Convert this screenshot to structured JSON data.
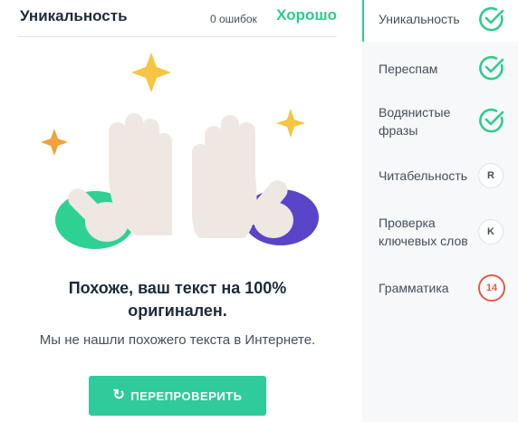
{
  "panel": {
    "title": "Уникальность",
    "errors": "0 ошибок",
    "verdict": "Хорошо"
  },
  "result": {
    "title": "Похоже, ваш текст на 100% оригинален.",
    "subtitle": "Мы не нашли похожего текста в Интернете.",
    "recheck_label": "ПЕРЕПРОВЕРИТЬ"
  },
  "sidebar": {
    "items": [
      {
        "label": "Уникальность",
        "status": "check",
        "active": true
      },
      {
        "label": "Переспам",
        "status": "check",
        "active": false
      },
      {
        "label": "Водянистые фразы",
        "status": "check",
        "active": false
      },
      {
        "label": "Читабельность",
        "status": "R",
        "active": false
      },
      {
        "label": "Проверка ключевых слов",
        "status": "K",
        "active": false
      },
      {
        "label": "Грамматика",
        "status": "14",
        "active": false
      }
    ]
  },
  "colors": {
    "accent": "#2fcb8c",
    "button": "#2fcb9a",
    "error": "#e8584a",
    "text": "#1e2a3a"
  }
}
